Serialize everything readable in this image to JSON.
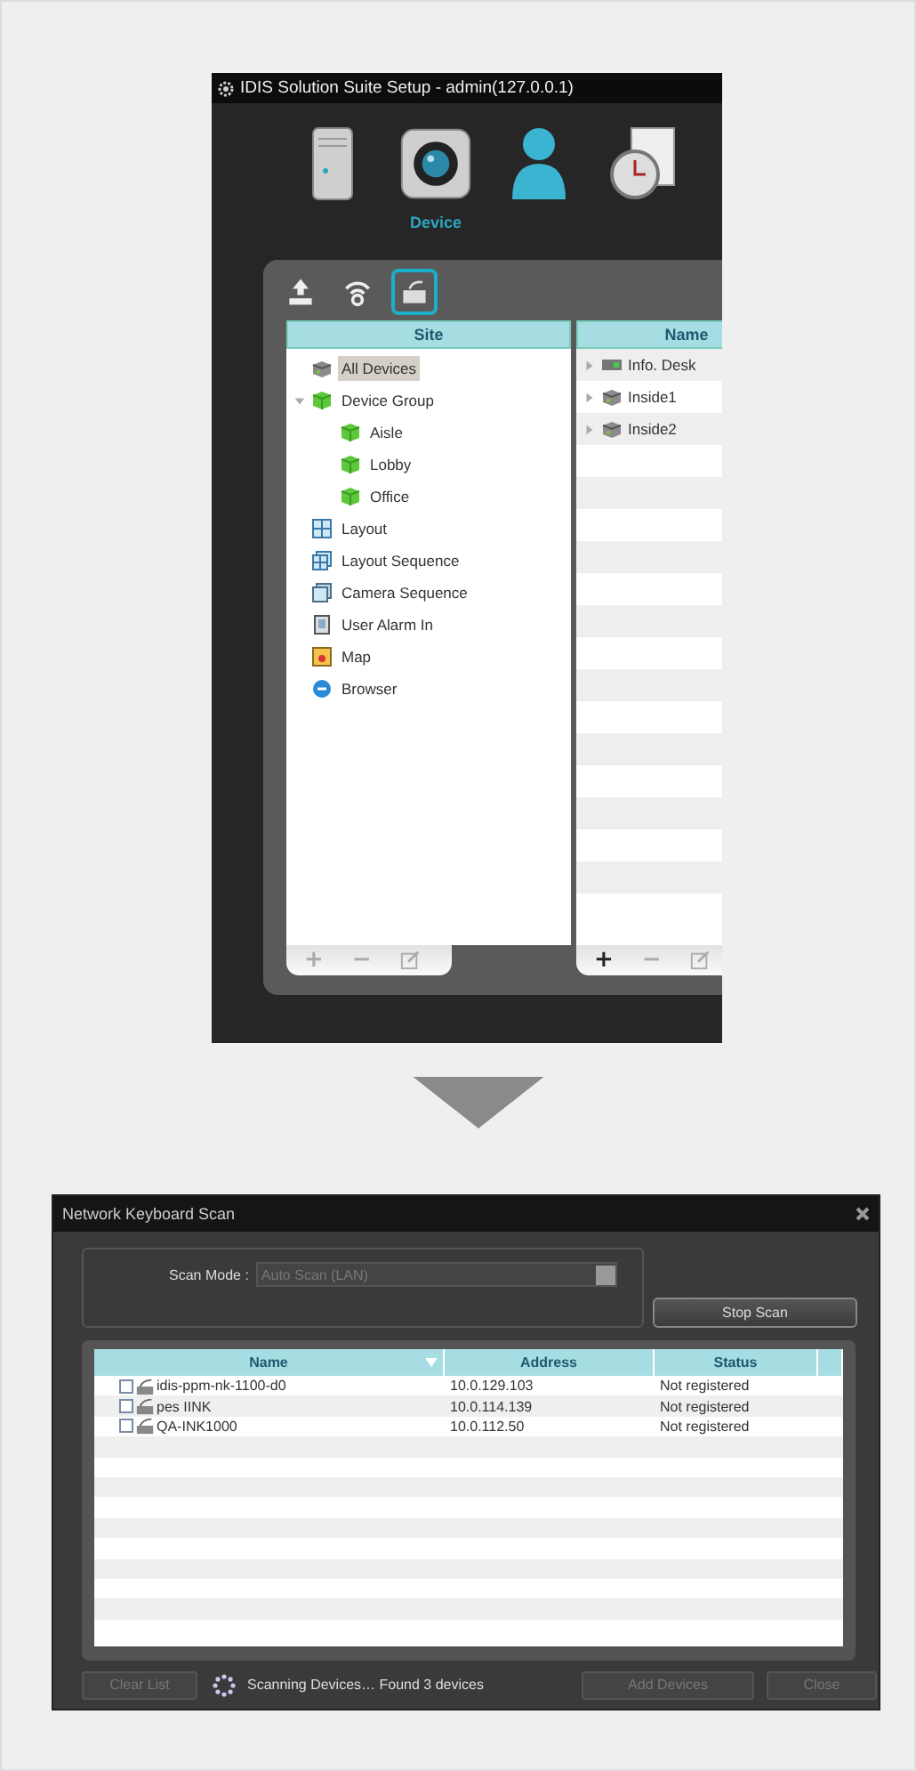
{
  "setup_window": {
    "title": "IDIS Solution Suite Setup - admin(127.0.0.1)",
    "categories": [
      {
        "kind": "server"
      },
      {
        "kind": "camera",
        "label": "Device"
      },
      {
        "kind": "user"
      },
      {
        "kind": "log"
      }
    ],
    "toolbar": [
      {
        "kind": "upload",
        "selected": false
      },
      {
        "kind": "network",
        "selected": false
      },
      {
        "kind": "keyboard",
        "selected": true
      }
    ],
    "site_panel": {
      "heading": "Site",
      "tree": [
        {
          "label": "All Devices",
          "kind": "devices",
          "selected": true
        },
        {
          "label": "Device Group",
          "kind": "group",
          "selected": false,
          "expanded": true,
          "children": [
            {
              "label": "Aisle",
              "kind": "group",
              "selected": false
            },
            {
              "label": "Lobby",
              "kind": "group",
              "selected": false
            },
            {
              "label": "Office",
              "kind": "group",
              "selected": false
            }
          ]
        },
        {
          "label": "Layout",
          "kind": "layout",
          "selected": false
        },
        {
          "label": "Layout Sequence",
          "kind": "layout_sequence",
          "selected": false
        },
        {
          "label": "Camera Sequence",
          "kind": "camera_sequence",
          "selected": false
        },
        {
          "label": "User Alarm In",
          "kind": "alarm",
          "selected": false
        },
        {
          "label": "Map",
          "kind": "map",
          "selected": false
        },
        {
          "label": "Browser",
          "kind": "browser",
          "selected": false
        }
      ],
      "footer": [
        "+",
        "−"
      ]
    },
    "name_panel": {
      "heading": "Name",
      "rows": [
        {
          "label": "Info. Desk",
          "kind": "keyboard"
        },
        {
          "label": "Inside1",
          "kind": "devices"
        },
        {
          "label": "Inside2",
          "kind": "devices"
        }
      ],
      "footer": [
        "+",
        "−"
      ]
    }
  },
  "scan_dialog": {
    "title": "Network Keyboard Scan",
    "scan_mode": {
      "label": "Scan Mode :",
      "value": "Auto Scan (LAN)",
      "disabled": true
    },
    "stop_button": "Stop Scan",
    "columns": [
      {
        "label": "Name",
        "sorted": true
      },
      {
        "label": "Address",
        "sorted": false
      },
      {
        "label": "Status",
        "sorted": false
      }
    ],
    "rows": [
      {
        "name": "idis-ppm-nk-1100-d0",
        "address": "10.0.129.103",
        "status": "Not registered",
        "checked": false
      },
      {
        "name": "pes IINK",
        "address": "10.0.114.139",
        "status": "Not registered",
        "checked": false
      },
      {
        "name": "QA-INK1000",
        "address": "10.0.112.50",
        "status": "Not registered",
        "checked": false
      }
    ],
    "footer": {
      "clear_button": {
        "label": "Clear List",
        "disabled": true
      },
      "status": "Scanning Devices… Found 3 devices",
      "add_button": {
        "label": "Add Devices",
        "disabled": true
      },
      "close_button": {
        "label": "Close",
        "disabled": true
      }
    }
  }
}
